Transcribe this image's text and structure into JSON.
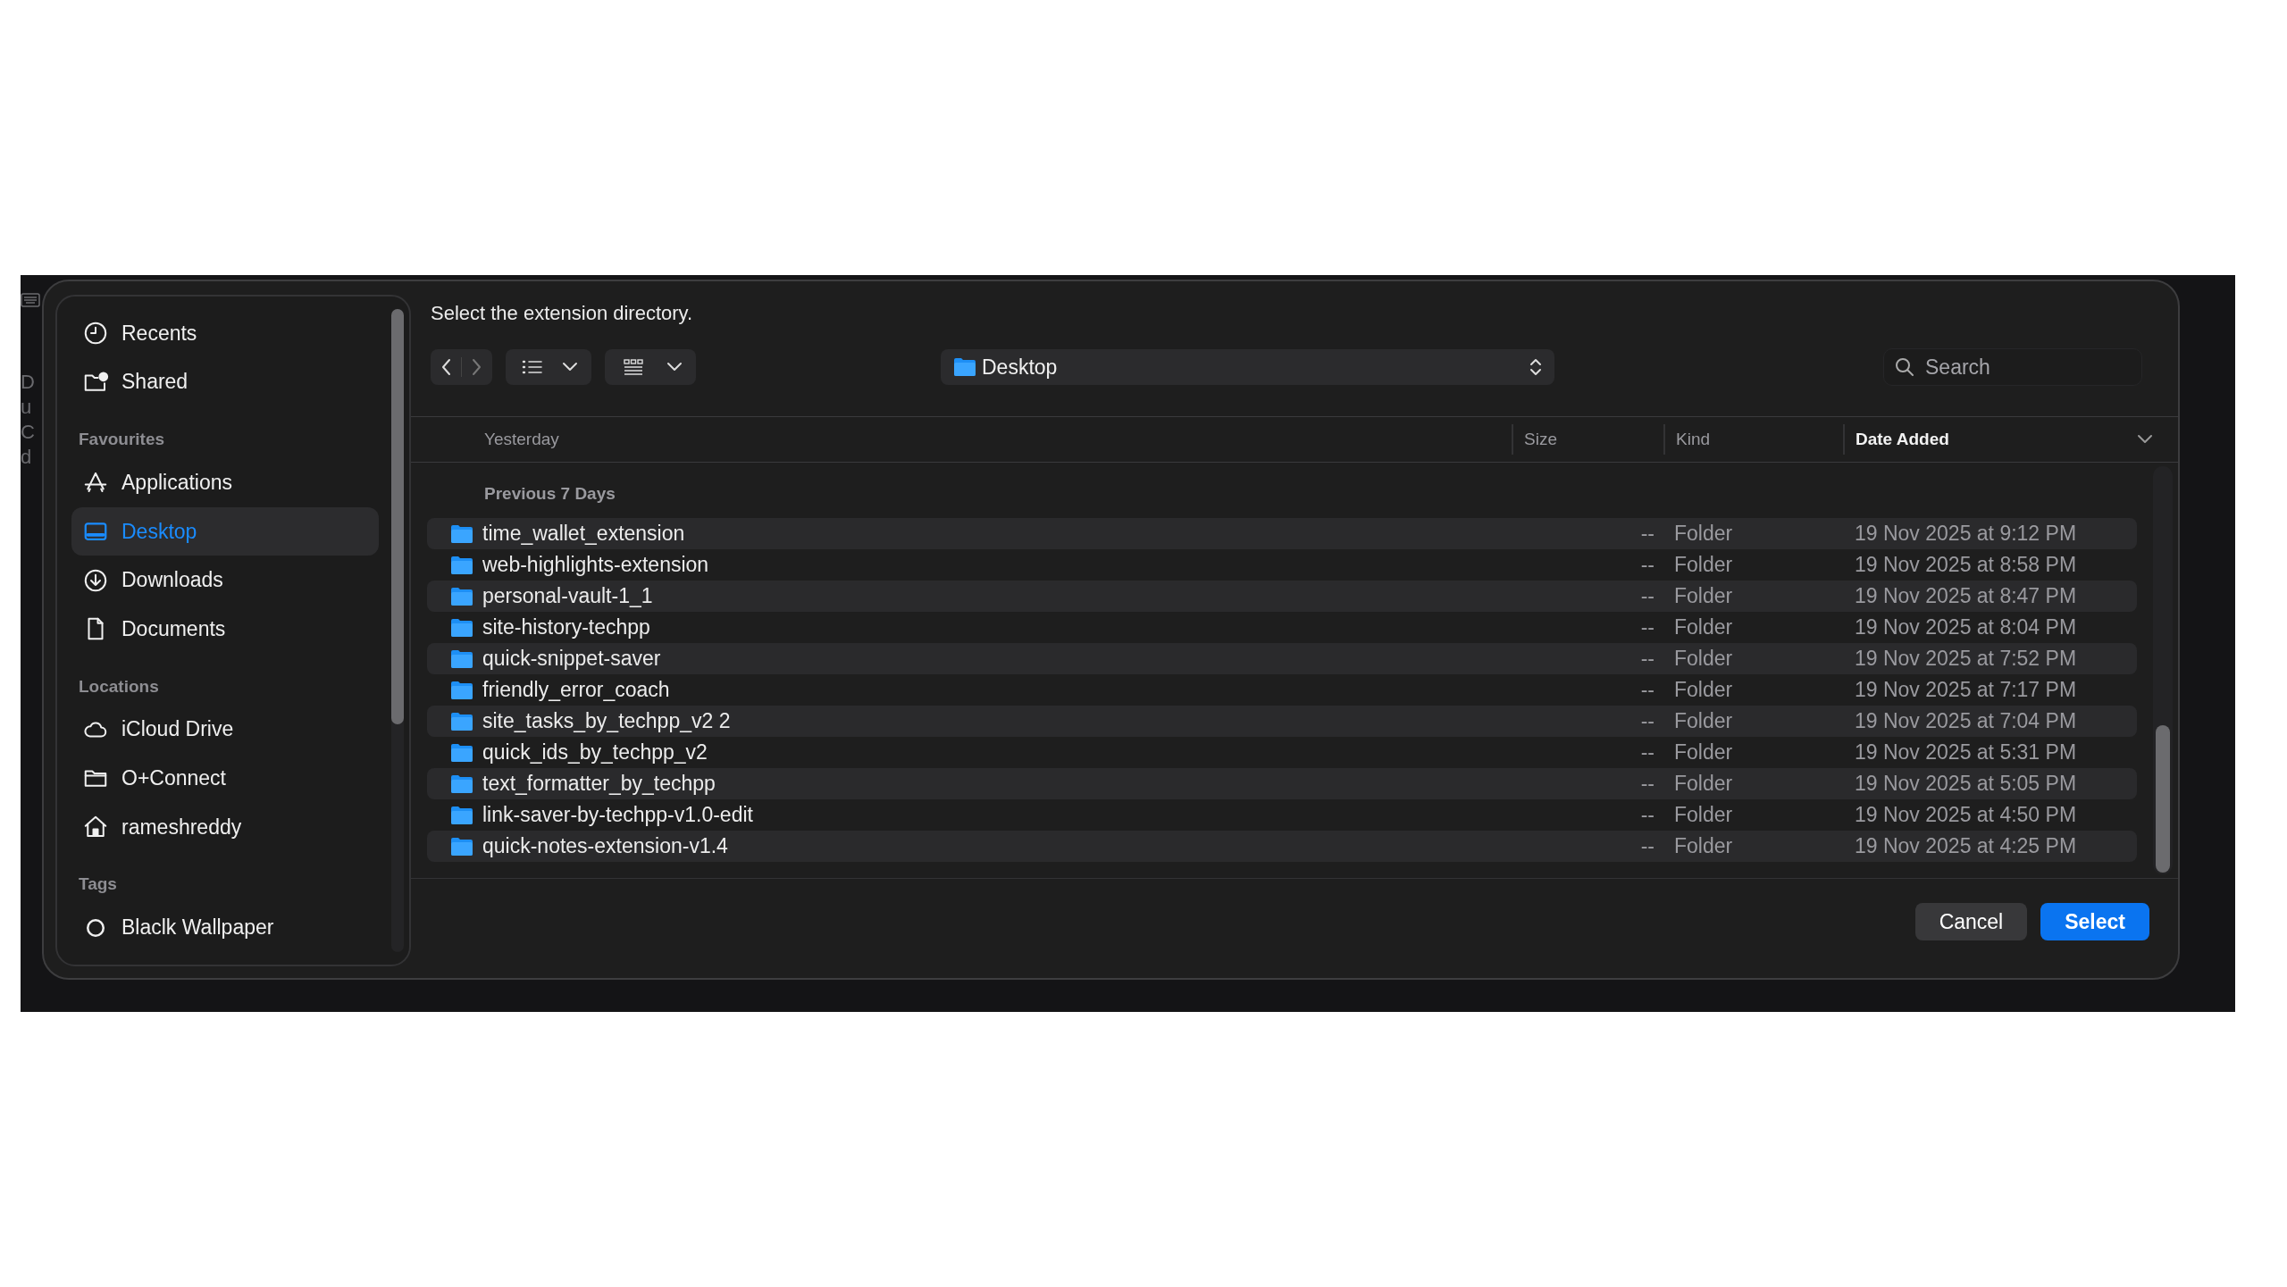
{
  "background_app": {
    "text_lines": [
      "D",
      "u",
      "C",
      "d"
    ]
  },
  "sidebar": {
    "sections": [
      {
        "items": [
          {
            "label": "Recents",
            "kind": "clock",
            "selected": false
          },
          {
            "label": "Shared",
            "kind": "shared",
            "selected": false
          }
        ]
      },
      {
        "heading": "Favourites",
        "items": [
          {
            "label": "Applications",
            "kind": "apps",
            "selected": false
          },
          {
            "label": "Desktop",
            "kind": "desktop",
            "selected": true
          },
          {
            "label": "Downloads",
            "kind": "download",
            "selected": false
          },
          {
            "label": "Documents",
            "kind": "doc",
            "selected": false
          }
        ]
      },
      {
        "heading": "Locations",
        "items": [
          {
            "label": "iCloud Drive",
            "kind": "cloud",
            "selected": false
          },
          {
            "label": "O+Connect",
            "kind": "folder",
            "selected": false
          },
          {
            "label": "rameshreddy",
            "kind": "home",
            "selected": false
          }
        ]
      },
      {
        "heading": "Tags",
        "items": [
          {
            "label": "Blaclk Wallpaper",
            "kind": "tag",
            "selected": false
          }
        ]
      }
    ]
  },
  "prompt": "Select the extension directory.",
  "location": "Desktop",
  "search": {
    "placeholder": "Search"
  },
  "table": {
    "columns": [
      {
        "label": "Yesterday",
        "sorted": false
      },
      {
        "label": "Size",
        "sorted": false
      },
      {
        "label": "Kind",
        "sorted": false
      },
      {
        "label": "Date Added",
        "sorted": true
      }
    ],
    "group": "Previous 7 Days",
    "rows": [
      {
        "name": "time_wallet_extension",
        "size": "--",
        "kind": "Folder",
        "date": "19 Nov 2025 at 9:12 PM"
      },
      {
        "name": "web-highlights-extension",
        "size": "--",
        "kind": "Folder",
        "date": "19 Nov 2025 at 8:58 PM"
      },
      {
        "name": "personal-vault-1_1",
        "size": "--",
        "kind": "Folder",
        "date": "19 Nov 2025 at 8:47 PM"
      },
      {
        "name": "site-history-techpp",
        "size": "--",
        "kind": "Folder",
        "date": "19 Nov 2025 at 8:04 PM"
      },
      {
        "name": "quick-snippet-saver",
        "size": "--",
        "kind": "Folder",
        "date": "19 Nov 2025 at 7:52 PM"
      },
      {
        "name": "friendly_error_coach",
        "size": "--",
        "kind": "Folder",
        "date": "19 Nov 2025 at 7:17 PM"
      },
      {
        "name": "site_tasks_by_techpp_v2 2",
        "size": "--",
        "kind": "Folder",
        "date": "19 Nov 2025 at 7:04 PM"
      },
      {
        "name": "quick_ids_by_techpp_v2",
        "size": "--",
        "kind": "Folder",
        "date": "19 Nov 2025 at 5:31 PM"
      },
      {
        "name": "text_formatter_by_techpp",
        "size": "--",
        "kind": "Folder",
        "date": "19 Nov 2025 at 5:05 PM"
      },
      {
        "name": "link-saver-by-techpp-v1.0-edit",
        "size": "--",
        "kind": "Folder",
        "date": "19 Nov 2025 at 4:50 PM"
      },
      {
        "name": "quick-notes-extension-v1.4",
        "size": "--",
        "kind": "Folder",
        "date": "19 Nov 2025 at 4:25 PM"
      }
    ]
  },
  "buttons": [
    {
      "label": "Cancel",
      "kind": "secondary"
    },
    {
      "label": "Select",
      "kind": "primary"
    }
  ]
}
